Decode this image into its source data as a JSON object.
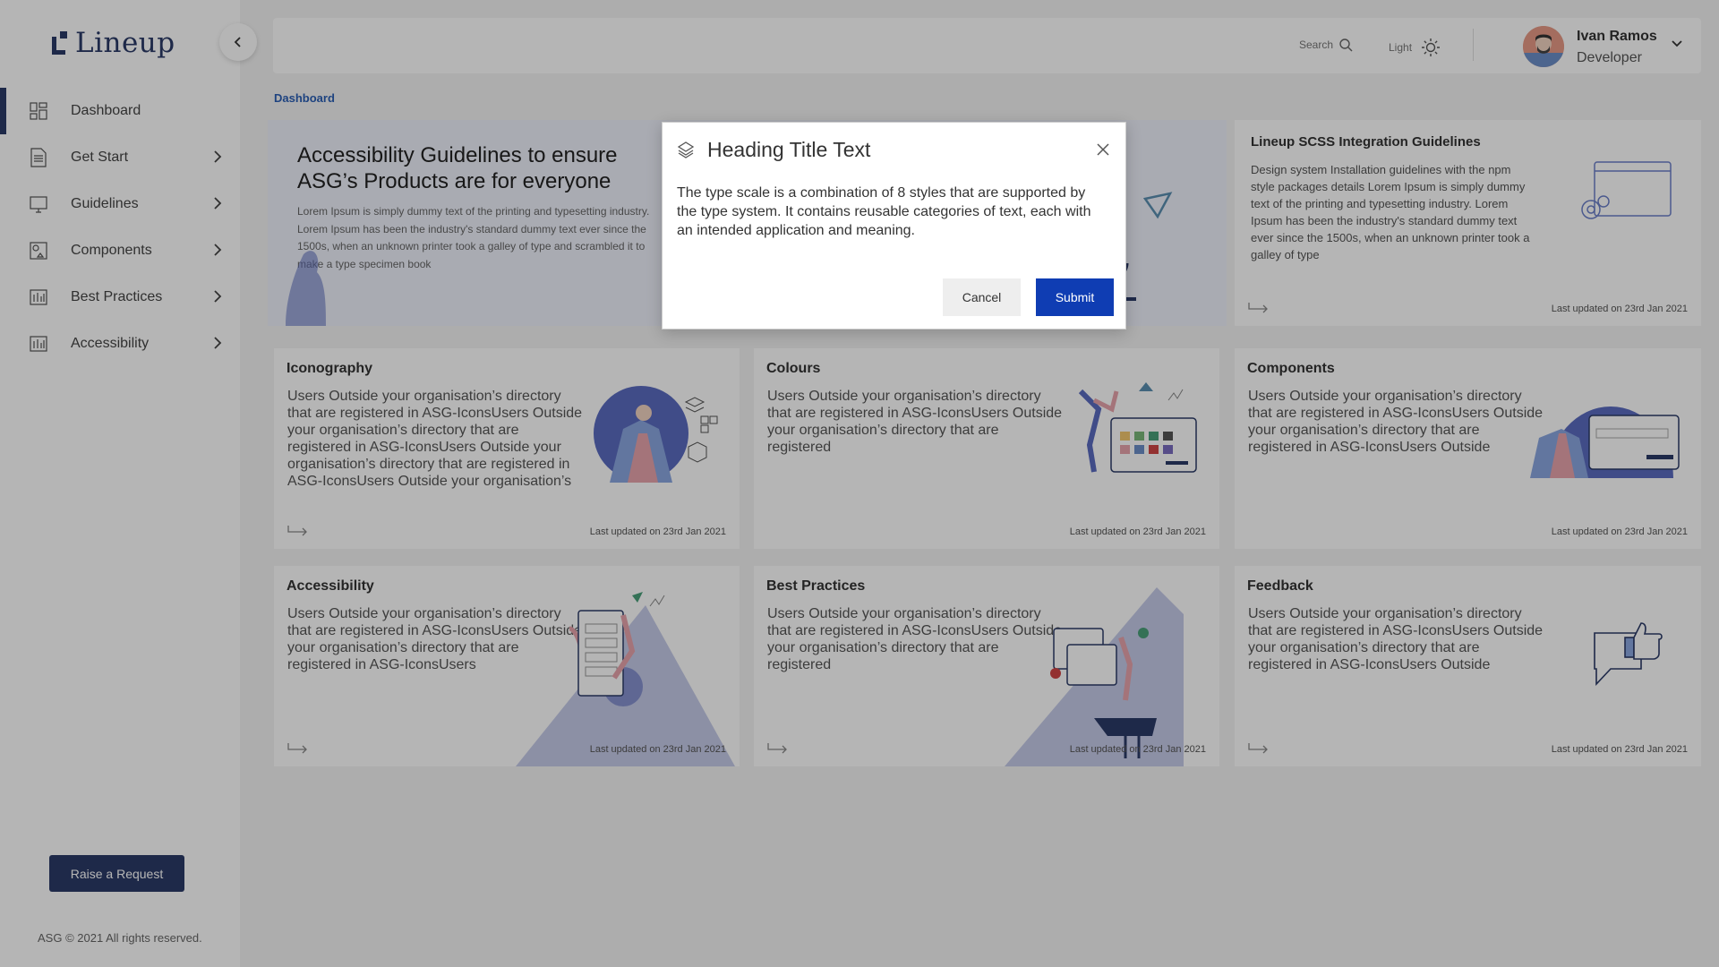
{
  "brand": {
    "name": "Lineup"
  },
  "sidebar": {
    "items": [
      {
        "label": "Dashboard",
        "icon": "dashboard-icon",
        "active": true
      },
      {
        "label": "Get Start",
        "icon": "document-icon"
      },
      {
        "label": "Guidelines",
        "icon": "monitor-icon"
      },
      {
        "label": "Components",
        "icon": "components-icon"
      },
      {
        "label": "Best Practices",
        "icon": "chart-icon"
      },
      {
        "label": "Accessibility",
        "icon": "chart-icon"
      }
    ],
    "raise_label": "Raise a Request",
    "copyright": "ASG © 2021 All rights reserved."
  },
  "topbar": {
    "search_label": "Search",
    "theme_label": "Light",
    "user_name": "Ivan Ramos",
    "user_role": "Developer"
  },
  "breadcrumb": "Dashboard",
  "hero": {
    "title": "Accessibility Guidelines to ensure ASG’s Products are for everyone",
    "text": "Lorem Ipsum is simply dummy text of the printing and typesetting industry. Lorem Ipsum has been the industry's standard dummy text ever since the 1500s, when an unknown printer took a galley of type and scrambled it to make a type specimen book"
  },
  "scss_card": {
    "title": "Lineup SCSS Integration Guidelines",
    "text": "Design system Installation guidelines with the npm style packages details Lorem Ipsum is simply dummy text of the printing and typesetting industry. Lorem Ipsum has been the industry's standard dummy text ever since the 1500s, when an unknown printer took a galley of type",
    "updated": "Last updated on  23rd Jan 2021"
  },
  "cards": [
    {
      "title": "Iconography",
      "text": "Users Outside your organisation’s directory that are registered in ASG-IconsUsers Outside your organisation’s directory that are registered in ASG-IconsUsers Outside your organisation’s directory that are registered in ASG-IconsUsers Outside your organisation’s",
      "updated": "Last updated on  23rd Jan 2021"
    },
    {
      "title": "Colours",
      "text": "Users Outside your organisation’s directory that are registered in ASG-IconsUsers Outside your organisation’s directory that are registered",
      "updated": "Last updated on  23rd Jan 2021"
    },
    {
      "title": "Components",
      "text": "Users Outside your organisation’s directory that are registered in ASG-IconsUsers Outside your organisation’s directory that are registered in ASG-IconsUsers Outside",
      "updated": "Last updated on  23rd Jan 2021"
    },
    {
      "title": "Accessibility",
      "text": "Users Outside your organisation’s directory that are registered in ASG-IconsUsers Outside your organisation’s directory that are registered in ASG-IconsUsers",
      "updated": "Last updated on  23rd Jan 2021"
    },
    {
      "title": "Best Practices",
      "text": "Users Outside your organisation’s directory that are registered in ASG-IconsUsers Outside your organisation’s directory that are registered",
      "updated": "Last updated on  23rd Jan 2021"
    },
    {
      "title": "Feedback",
      "text": "Users Outside your organisation’s directory that are registered in ASG-IconsUsers Outside your organisation’s directory that are registered in ASG-IconsUsers Outside",
      "updated": "Last updated on  23rd Jan 2021"
    }
  ],
  "modal": {
    "title": "Heading Title Text",
    "body": "The type scale is a combination of 8 styles that are supported by the type system. It contains reusable categories of text, each with an intended application and meaning.",
    "cancel_label": "Cancel",
    "submit_label": "Submit"
  },
  "colors": {
    "brand": "#2b3a67",
    "accent": "#2b5fb5",
    "submit": "#0f3db3",
    "illustration": "#5b6bc0"
  }
}
